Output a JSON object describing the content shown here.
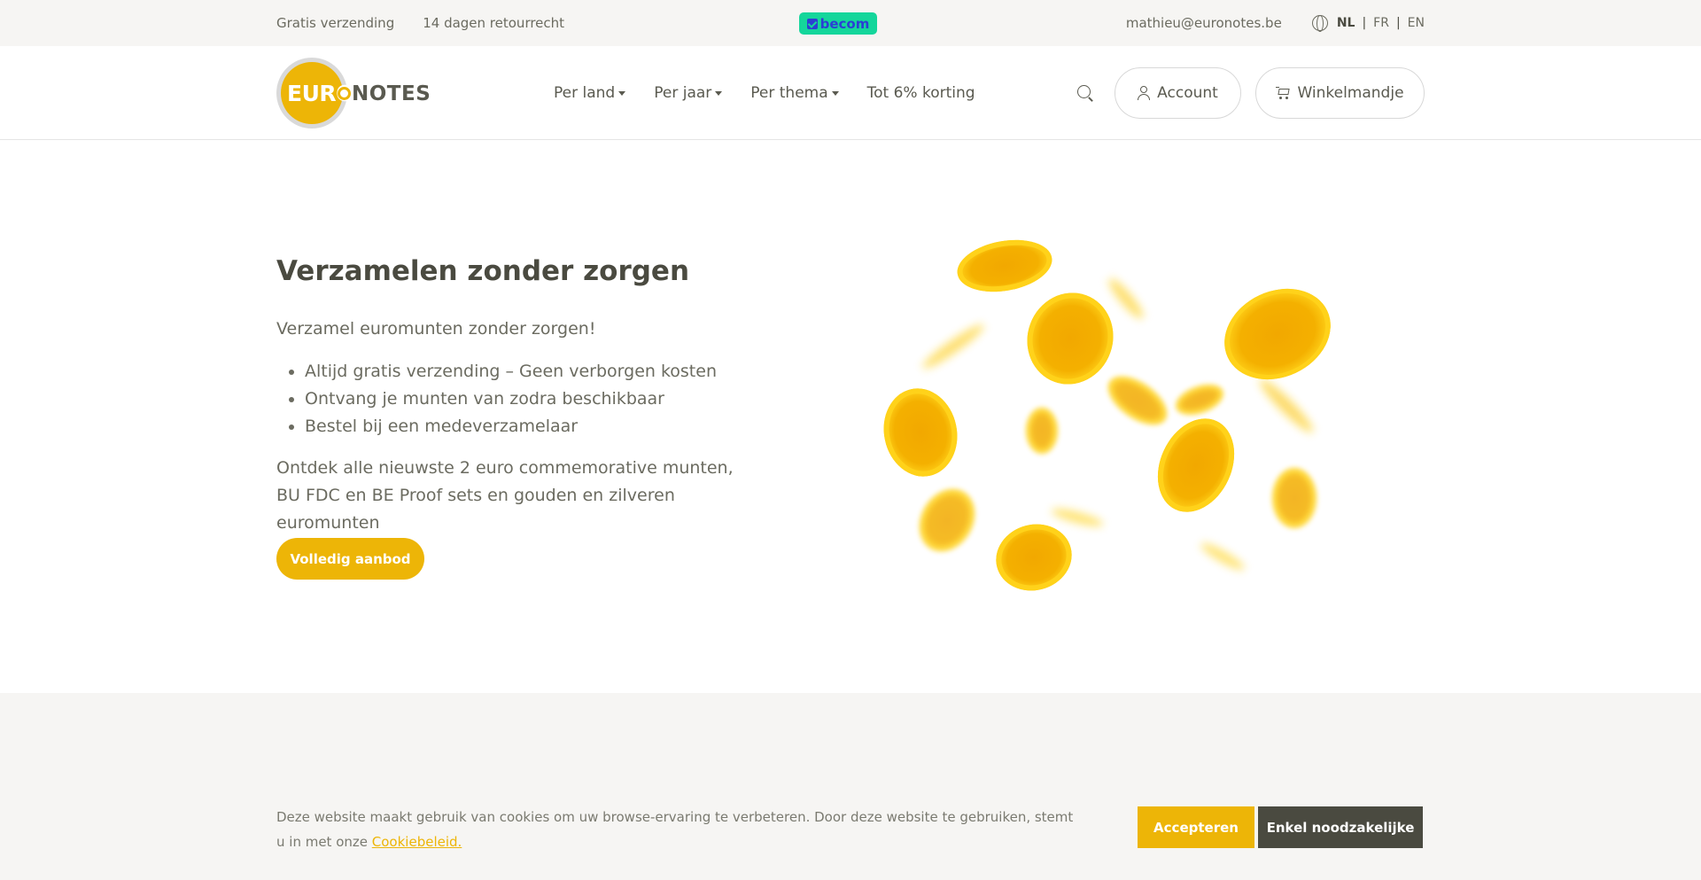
{
  "topbar": {
    "usp1": "Gratis verzending",
    "usp2": "14 dagen retourrecht",
    "badge": "becom",
    "email": "mathieu@euronotes.be",
    "languages": [
      {
        "label": "NL",
        "active": true
      },
      {
        "label": "FR",
        "active": false
      },
      {
        "label": "EN",
        "active": false
      }
    ]
  },
  "header": {
    "logo_left": "EURO",
    "logo_right": "NOTES",
    "nav": [
      {
        "label": "Per land",
        "dropdown": true
      },
      {
        "label": "Per jaar",
        "dropdown": true
      },
      {
        "label": "Per thema",
        "dropdown": true
      },
      {
        "label": "Tot 6% korting",
        "dropdown": false
      }
    ],
    "account_label": "Account",
    "cart_label": "Winkelmandje"
  },
  "hero": {
    "title": "Verzamelen zonder zorgen",
    "subtitle": "Verzamel euromunten zonder zorgen!",
    "bullets": [
      "Altijd gratis verzending – Geen verborgen kosten",
      "Ontvang je munten van zodra beschikbaar",
      "Bestel bij een medeverzamelaar"
    ],
    "description": "Ontdek alle nieuwste 2 euro commemorative munten, BU FDC en BE Proof sets en gouden en zilveren euromunten",
    "cta": "Volledig aanbod"
  },
  "cookie": {
    "text": "Deze website maakt gebruik van cookies om uw browse-ervaring te verbeteren. Door deze website te gebruiken, stemt u in met onze",
    "link": "Cookiebeleid.",
    "accept": "Accepteren",
    "necessary": "Enkel noodzakelijke"
  },
  "colors": {
    "accent": "#edb507",
    "dark": "#4a4a40",
    "badge_bg": "#14d69b",
    "badge_text": "#2b3fd3"
  }
}
